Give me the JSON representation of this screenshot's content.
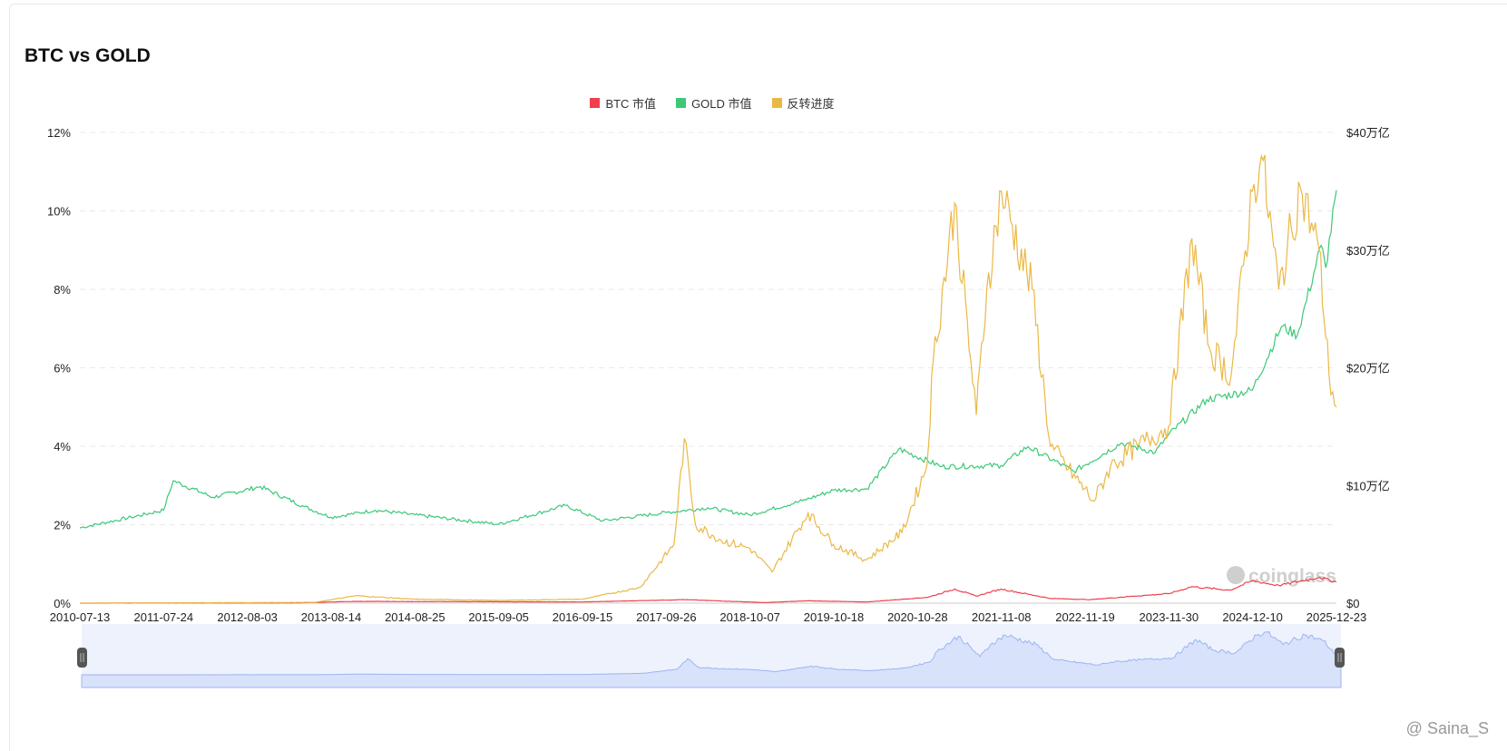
{
  "title": "BTC vs GOLD",
  "watermark": "@ Saina_S",
  "logo": "coinglass",
  "chart_data": {
    "type": "line",
    "title": "BTC vs GOLD",
    "legend": [
      {
        "name": "BTC 市值",
        "color": "#f0404d"
      },
      {
        "name": "GOLD 市值",
        "color": "#3cc878"
      },
      {
        "name": "反转进度",
        "color": "#ebb845"
      }
    ],
    "legend_position": "top-center",
    "x_tick_labels": [
      "2010-07-13",
      "2011-07-24",
      "2012-08-03",
      "2013-08-14",
      "2014-08-25",
      "2015-09-05",
      "2016-09-15",
      "2017-09-26",
      "2018-10-07",
      "2019-10-18",
      "2020-10-28",
      "2021-11-08",
      "2022-11-19",
      "2023-11-30",
      "2024-12-10",
      "2025-12-23"
    ],
    "x_range": [
      "2010-07-13",
      "2025-12-23"
    ],
    "left_axis": {
      "ticks": [
        "0%",
        "2%",
        "4%",
        "6%",
        "8%",
        "10%",
        "12%"
      ],
      "range": [
        0,
        12
      ],
      "unit": "%"
    },
    "right_axis": {
      "ticks": [
        "$0",
        "$10万亿",
        "$20万亿",
        "$30万亿",
        "$40万亿"
      ],
      "range": [
        0,
        40
      ],
      "unit": "万亿 USD"
    },
    "grid": true,
    "series": [
      {
        "name": "GOLD 市值",
        "axis": "right",
        "points": [
          [
            "2010-07-13",
            6.4
          ],
          [
            "2011-03-01",
            7.3
          ],
          [
            "2011-07-24",
            7.9
          ],
          [
            "2011-09-05",
            10.4
          ],
          [
            "2012-03-01",
            9.0
          ],
          [
            "2012-10-01",
            9.9
          ],
          [
            "2013-04-15",
            8.2
          ],
          [
            "2013-08-14",
            7.3
          ],
          [
            "2014-03-01",
            7.9
          ],
          [
            "2014-08-25",
            7.5
          ],
          [
            "2015-09-05",
            6.7
          ],
          [
            "2016-07-01",
            8.3
          ],
          [
            "2016-12-15",
            7.0
          ],
          [
            "2017-09-26",
            7.7
          ],
          [
            "2018-04-01",
            8.1
          ],
          [
            "2018-10-07",
            7.5
          ],
          [
            "2019-06-01",
            8.7
          ],
          [
            "2019-10-18",
            9.6
          ],
          [
            "2020-03-15",
            9.7
          ],
          [
            "2020-08-06",
            13.1
          ],
          [
            "2021-02-15",
            11.6
          ],
          [
            "2021-11-08",
            11.7
          ],
          [
            "2022-03-08",
            13.3
          ],
          [
            "2022-10-01",
            11.2
          ],
          [
            "2023-05-01",
            13.6
          ],
          [
            "2023-10-01",
            12.8
          ],
          [
            "2023-11-30",
            14.3
          ],
          [
            "2024-05-20",
            17.3
          ],
          [
            "2024-12-10",
            18.1
          ],
          [
            "2025-04-20",
            23.5
          ],
          [
            "2025-07-01",
            22.8
          ],
          [
            "2025-10-15",
            30.4
          ],
          [
            "2025-11-05",
            28.5
          ],
          [
            "2025-12-23",
            35.1
          ]
        ]
      },
      {
        "name": "BTC 市值",
        "axis": "right",
        "points": [
          [
            "2010-07-13",
            0
          ],
          [
            "2013-03-01",
            0.02
          ],
          [
            "2013-12-01",
            0.15
          ],
          [
            "2016-09-15",
            0.1
          ],
          [
            "2017-12-15",
            0.3
          ],
          [
            "2018-12-15",
            0.05
          ],
          [
            "2019-06-25",
            0.2
          ],
          [
            "2020-03-15",
            0.1
          ],
          [
            "2020-12-15",
            0.5
          ],
          [
            "2021-04-14",
            1.2
          ],
          [
            "2021-07-20",
            0.6
          ],
          [
            "2021-11-08",
            1.2
          ],
          [
            "2022-06-18",
            0.4
          ],
          [
            "2022-12-15",
            0.3
          ],
          [
            "2023-07-01",
            0.6
          ],
          [
            "2023-11-30",
            0.8
          ],
          [
            "2024-03-14",
            1.4
          ],
          [
            "2024-09-01",
            1.1
          ],
          [
            "2024-12-10",
            1.9
          ],
          [
            "2025-04-08",
            1.5
          ],
          [
            "2025-10-06",
            2.2
          ],
          [
            "2025-12-23",
            1.8
          ]
        ]
      },
      {
        "name": "反转进度",
        "axis": "left",
        "points": [
          [
            "2010-07-13",
            0
          ],
          [
            "2013-06-01",
            0.02
          ],
          [
            "2013-11-30",
            0.19
          ],
          [
            "2014-08-25",
            0.1
          ],
          [
            "2015-09-05",
            0.07
          ],
          [
            "2016-09-15",
            0.1
          ],
          [
            "2017-06-01",
            0.4
          ],
          [
            "2017-11-01",
            1.5
          ],
          [
            "2017-12-17",
            4.2
          ],
          [
            "2018-02-05",
            2.0
          ],
          [
            "2018-06-01",
            1.6
          ],
          [
            "2018-10-07",
            1.4
          ],
          [
            "2019-01-15",
            0.8
          ],
          [
            "2019-06-26",
            2.3
          ],
          [
            "2019-10-18",
            1.5
          ],
          [
            "2020-03-13",
            1.1
          ],
          [
            "2020-08-20",
            1.8
          ],
          [
            "2020-12-10",
            3.5
          ],
          [
            "2021-01-08",
            6.2
          ],
          [
            "2021-04-14",
            10.2
          ],
          [
            "2021-07-20",
            4.8
          ],
          [
            "2021-09-05",
            8.0
          ],
          [
            "2021-11-10",
            10.5
          ],
          [
            "2022-03-28",
            8.0
          ],
          [
            "2022-06-18",
            4.0
          ],
          [
            "2022-12-30",
            2.6
          ],
          [
            "2023-03-15",
            3.5
          ],
          [
            "2023-07-14",
            4.0
          ],
          [
            "2023-11-30",
            4.5
          ],
          [
            "2024-03-14",
            9.3
          ],
          [
            "2024-06-01",
            6.5
          ],
          [
            "2024-09-06",
            5.8
          ],
          [
            "2024-12-10",
            10.5
          ],
          [
            "2025-01-20",
            11.4
          ],
          [
            "2025-04-08",
            8.0
          ],
          [
            "2025-07-14",
            10.6
          ],
          [
            "2025-10-06",
            9.0
          ],
          [
            "2025-11-20",
            5.8
          ],
          [
            "2025-12-23",
            5.0
          ]
        ]
      }
    ]
  }
}
